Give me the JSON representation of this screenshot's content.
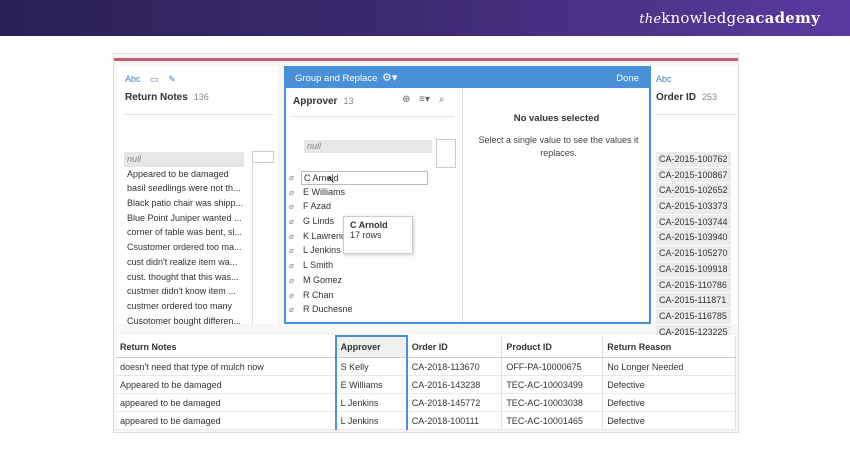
{
  "brand": {
    "the": "the",
    "knowledge": "knowledge",
    "academy": "academy"
  },
  "left_field": {
    "title": "Return Notes",
    "count": "136",
    "values": [
      "null",
      "Appeared to be damaged",
      "basil seedlings were not th...",
      "Black patio chair was shipp...",
      "Blue Point Juniper wanted ...",
      "corner of table was bent, sl...",
      "Csustomer ordered too ma...",
      "cust didn't realize item wa...",
      "cust. thought that this was...",
      "custmer didn't know item ...",
      "custmer ordered too many",
      "Cusotomer bought differen..."
    ]
  },
  "dialog": {
    "title": "Group and Replace",
    "done": "Done",
    "approver_title": "Approver",
    "approver_count": "13",
    "null_label": "null",
    "approvers": [
      "C Arnold",
      "E Williams",
      "F Azad",
      "G Linds",
      "K Lawrence",
      "L Jenkins",
      "L Smith",
      "M Gomez",
      "R Chan",
      "R Duchesne"
    ],
    "tooltip_name": "C Arnold",
    "tooltip_rows": "17 rows",
    "no_values": "No values selected",
    "no_values_sub": "Select a single value to see the values it replaces."
  },
  "right_field": {
    "title": "Order ID",
    "count": "253",
    "values": [
      "CA-2015-100762",
      "CA-2015-100867",
      "CA-2015-102652",
      "CA-2015-103373",
      "CA-2015-103744",
      "CA-2015-103940",
      "CA-2015-105270",
      "CA-2015-109918",
      "CA-2015-110786",
      "CA-2015-111871",
      "CA-2015-116785",
      "CA-2015-123225"
    ]
  },
  "grid": {
    "headers": [
      "Return Notes",
      "Approver",
      "Order ID",
      "Product ID",
      "Return Reason"
    ],
    "rows": [
      [
        "doesn't need that type of mulch now",
        "S Kelly",
        "CA-2018-113670",
        "OFF-PA-10000675",
        "No Longer Needed"
      ],
      [
        "Appeared to be damaged",
        "E Williams",
        "CA-2016-143238",
        "TEC-AC-10003499",
        "Defective"
      ],
      [
        "appeared to be damaged",
        "L Jenkins",
        "CA-2018-145772",
        "TEC-AC-10003038",
        "Defective"
      ],
      [
        "appeared to be damaged",
        "L Jenkins",
        "CA-2018-100111",
        "TEC-AC-10001465",
        "Defective"
      ]
    ]
  },
  "colors": {
    "accent": "#4a90d9",
    "banner": "#2a1f55",
    "redline": "#d0576c"
  }
}
